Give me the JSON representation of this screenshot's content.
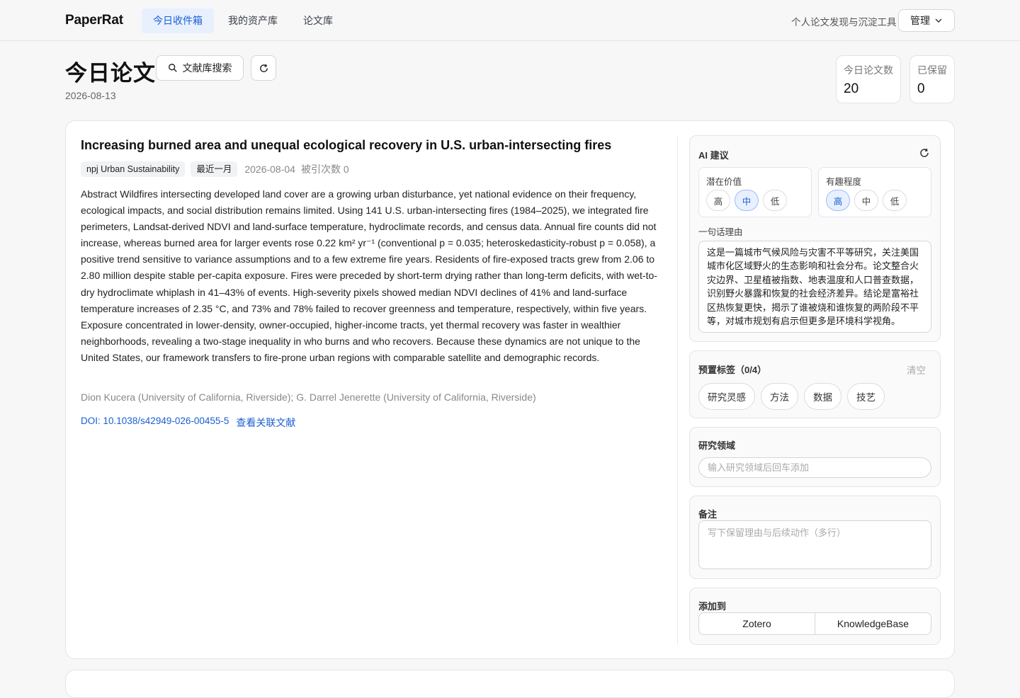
{
  "app": {
    "brand": "PaperRat",
    "tagline": "个人论文发现与沉淀工具",
    "admin_label": "管理"
  },
  "nav": [
    {
      "label": "今日收件箱",
      "active": true
    },
    {
      "label": "我的资产库",
      "active": false
    },
    {
      "label": "论文库",
      "active": false
    }
  ],
  "header": {
    "title": "今日论文",
    "search_label": "文献库搜索",
    "date": "2026-08-13"
  },
  "stats": [
    {
      "label": "今日论文数",
      "value": "20"
    },
    {
      "label": "已保留",
      "value": "0"
    }
  ],
  "paper": {
    "title": "Increasing burned area and unequal ecological recovery in U.S. urban-intersecting fires",
    "journal": "npj Urban Sustainability",
    "recency": "最近一月",
    "pub_date": "2026-08-04",
    "citations": "被引次数 0",
    "abstract": "Abstract Wildfires intersecting developed land cover are a growing urban disturbance, yet national evidence on their frequency, ecological impacts, and social distribution remains limited. Using 141 U.S. urban-intersecting fires (1984–2025), we integrated fire perimeters, Landsat-derived NDVI and land-surface temperature, hydroclimate records, and census data. Annual fire counts did not increase, whereas burned area for larger events rose 0.22 km² yr⁻¹ (conventional p = 0.035; heteroskedasticity-robust p = 0.058), a positive trend sensitive to variance assumptions and to a few extreme fire years. Residents of fire-exposed tracts grew from 2.06 to 2.80 million despite stable per-capita exposure. Fires were preceded by short-term drying rather than long-term deficits, with wet-to-dry hydroclimate whiplash in 41–43% of events. High-severity pixels showed median NDVI declines of 41% and land-surface temperature increases of 2.35 °C, and 73% and 78% failed to recover greenness and temperature, respectively, within five years. Exposure concentrated in lower-density, owner-occupied, higher-income tracts, yet thermal recovery was faster in wealthier neighborhoods, revealing a two-stage inequality in who burns and who recovers. Because these dynamics are not unique to the United States, our framework transfers to fire-prone urban regions with comparable satellite and demographic records.",
    "authors": "Dion Kucera (University of California, Riverside); G. Darrel Jenerette (University of California, Riverside)",
    "doi": "DOI: 10.1038/s42949-026-00455-5",
    "related_label": "查看关联文献"
  },
  "ai": {
    "title": "AI 建议",
    "value_label": "潜在价值",
    "value_options": [
      "高",
      "中",
      "低"
    ],
    "value_selected": "中",
    "interest_label": "有趣程度",
    "interest_options": [
      "高",
      "中",
      "低"
    ],
    "interest_selected": "高",
    "reason_label": "一句话理由",
    "reason": "这是一篇城市气候风险与灾害不平等研究，关注美国城市化区域野火的生态影响和社会分布。论文整合火灾边界、卫星植被指数、地表温度和人口普查数据，识别野火暴露和恢复的社会经济差异。结论是富裕社区热恢复更快，揭示了谁被烧和谁恢复的两阶段不平等，对城市规划有启示但更多是环境科学视角。"
  },
  "tags": {
    "title": "预置标签（0/4）",
    "clear_label": "清空",
    "items": [
      "研究灵感",
      "方法",
      "数据",
      "技艺"
    ]
  },
  "field": {
    "title": "研究领域",
    "placeholder": "输入研究领域后回车添加"
  },
  "note": {
    "title": "备注",
    "placeholder": "写下保留理由与后续动作（多行）"
  },
  "add_to": {
    "title": "添加到",
    "options": [
      "Zotero",
      "KnowledgeBase"
    ]
  },
  "icons": {
    "search": "search-icon",
    "refresh": "refresh-icon",
    "chevron": "chevron-down-icon"
  },
  "colors": {
    "accent": "#1a5fd1",
    "accent_bg": "#e8f0fe"
  }
}
